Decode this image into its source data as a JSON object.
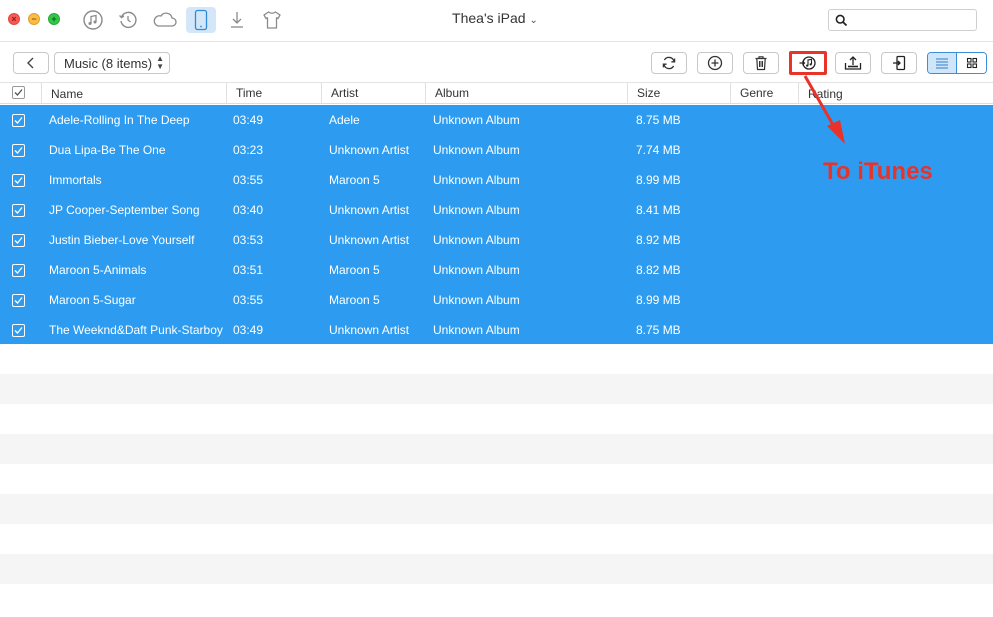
{
  "window": {
    "device_title": "Thea's iPad",
    "search_placeholder": ""
  },
  "top_icons": [
    "music-note-icon",
    "history-icon",
    "cloud-icon",
    "ipad-icon",
    "download-icon",
    "tshirt-icon"
  ],
  "toolbar": {
    "category_select": "Music (8 items)",
    "buttons": [
      "refresh",
      "add",
      "delete",
      "to-itunes",
      "export-to-computer",
      "import"
    ],
    "view_mode": "list"
  },
  "table": {
    "columns": [
      "Name",
      "Time",
      "Artist",
      "Album",
      "Size",
      "Genre",
      "Rating"
    ],
    "rows": [
      {
        "name": "Adele-Rolling In The Deep",
        "time": "03:49",
        "artist": "Adele",
        "album": "Unknown Album",
        "size": "8.75 MB",
        "genre": "",
        "checked": true
      },
      {
        "name": "Dua Lipa-Be The One",
        "time": "03:23",
        "artist": "Unknown Artist",
        "album": "Unknown Album",
        "size": "7.74 MB",
        "genre": "",
        "checked": true
      },
      {
        "name": "Immortals",
        "time": "03:55",
        "artist": "Maroon 5",
        "album": "Unknown Album",
        "size": "8.99 MB",
        "genre": "",
        "checked": true
      },
      {
        "name": "JP Cooper-September Song",
        "time": "03:40",
        "artist": "Unknown Artist",
        "album": "Unknown Album",
        "size": "8.41 MB",
        "genre": "",
        "checked": true
      },
      {
        "name": "Justin Bieber-Love Yourself",
        "time": "03:53",
        "artist": "Unknown Artist",
        "album": "Unknown Album",
        "size": "8.92 MB",
        "genre": "",
        "checked": true
      },
      {
        "name": "Maroon 5-Animals",
        "time": "03:51",
        "artist": "Maroon 5",
        "album": "Unknown Album",
        "size": "8.82 MB",
        "genre": "",
        "checked": true
      },
      {
        "name": "Maroon 5-Sugar",
        "time": "03:55",
        "artist": "Maroon 5",
        "album": "Unknown Album",
        "size": "8.99 MB",
        "genre": "",
        "checked": true
      },
      {
        "name": "The Weeknd&Daft Punk-Starboy",
        "time": "03:49",
        "artist": "Unknown Artist",
        "album": "Unknown Album",
        "size": "8.75 MB",
        "genre": "",
        "checked": true
      }
    ]
  },
  "annotation": {
    "text": "To iTunes",
    "color": "#e8322a"
  },
  "colors": {
    "selection": "#2d9cf0",
    "accent": "#3b8fd8"
  }
}
